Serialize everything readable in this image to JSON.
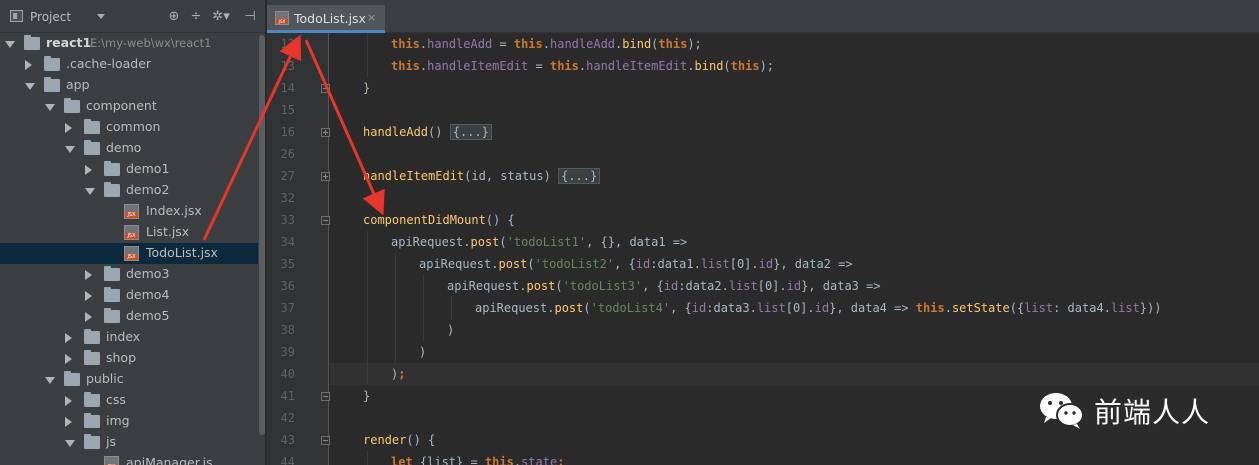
{
  "project_panel": {
    "title": "Project",
    "toolbar_icons": [
      "globe-sync-icon",
      "collapse-all-icon",
      "settings-gear-icon",
      "hide-panel-icon"
    ],
    "tree": [
      {
        "label": "react1",
        "path": "E:\\my-web\\wx\\react1",
        "type": "folder",
        "expanded": true,
        "depth": 0
      },
      {
        "label": ".cache-loader",
        "type": "folder",
        "expanded": false,
        "depth": 1
      },
      {
        "label": "app",
        "type": "folder",
        "expanded": true,
        "depth": 1
      },
      {
        "label": "component",
        "type": "folder",
        "expanded": true,
        "depth": 2
      },
      {
        "label": "common",
        "type": "folder",
        "expanded": false,
        "depth": 3
      },
      {
        "label": "demo",
        "type": "folder",
        "expanded": true,
        "depth": 3
      },
      {
        "label": "demo1",
        "type": "folder",
        "expanded": false,
        "depth": 4
      },
      {
        "label": "demo2",
        "type": "folder",
        "expanded": true,
        "depth": 4
      },
      {
        "label": "Index.jsx",
        "type": "file",
        "depth": 5
      },
      {
        "label": "List.jsx",
        "type": "file",
        "depth": 5
      },
      {
        "label": "TodoList.jsx",
        "type": "file",
        "depth": 5,
        "selected": true
      },
      {
        "label": "demo3",
        "type": "folder",
        "expanded": false,
        "depth": 4
      },
      {
        "label": "demo4",
        "type": "folder",
        "expanded": false,
        "depth": 4
      },
      {
        "label": "demo5",
        "type": "folder",
        "expanded": false,
        "depth": 4
      },
      {
        "label": "index",
        "type": "folder",
        "expanded": false,
        "depth": 3
      },
      {
        "label": "shop",
        "type": "folder",
        "expanded": false,
        "depth": 3
      },
      {
        "label": "public",
        "type": "folder",
        "expanded": true,
        "depth": 2
      },
      {
        "label": "css",
        "type": "folder",
        "expanded": false,
        "depth": 3
      },
      {
        "label": "img",
        "type": "folder",
        "expanded": false,
        "depth": 3
      },
      {
        "label": "js",
        "type": "folder",
        "expanded": true,
        "depth": 3
      },
      {
        "label": "apiManager.js",
        "type": "file",
        "depth": 4
      }
    ]
  },
  "editor": {
    "tab": {
      "label": "TodoList.jsx",
      "close": "×"
    },
    "lines": [
      {
        "num": "12",
        "indent": 2,
        "fold": null,
        "tokens": [
          [
            "kw",
            "this"
          ],
          [
            "pl",
            "."
          ],
          [
            "pr",
            "handleAdd"
          ],
          [
            "pl",
            " = "
          ],
          [
            "kw",
            "this"
          ],
          [
            "pl",
            "."
          ],
          [
            "pr",
            "handleAdd"
          ],
          [
            "pl",
            "."
          ],
          [
            "fn",
            "bind"
          ],
          [
            "pl",
            "("
          ],
          [
            "kw",
            "this"
          ],
          [
            "pl",
            ");"
          ]
        ]
      },
      {
        "num": "13",
        "indent": 2,
        "fold": null,
        "tokens": [
          [
            "kw",
            "this"
          ],
          [
            "pl",
            "."
          ],
          [
            "pr",
            "handleItemEdit"
          ],
          [
            "pl",
            " = "
          ],
          [
            "kw",
            "this"
          ],
          [
            "pl",
            "."
          ],
          [
            "pr",
            "handleItemEdit"
          ],
          [
            "pl",
            "."
          ],
          [
            "fn",
            "bind"
          ],
          [
            "pl",
            "("
          ],
          [
            "kw",
            "this"
          ],
          [
            "pl",
            ");"
          ]
        ]
      },
      {
        "num": "14",
        "indent": 1,
        "fold": "minus",
        "tokens": [
          [
            "pl",
            "}"
          ]
        ]
      },
      {
        "num": "15",
        "indent": 0,
        "fold": null,
        "tokens": []
      },
      {
        "num": "16",
        "indent": 1,
        "fold": "plus",
        "tokens": [
          [
            "fn",
            "handleAdd"
          ],
          [
            "pl",
            "() "
          ],
          [
            "fb",
            "{...}"
          ]
        ]
      },
      {
        "num": "26",
        "indent": 0,
        "fold": null,
        "tokens": []
      },
      {
        "num": "27",
        "indent": 1,
        "fold": "plus",
        "tokens": [
          [
            "fn",
            "handleItemEdit"
          ],
          [
            "pl",
            "(id, status) "
          ],
          [
            "fb",
            "{...}"
          ]
        ]
      },
      {
        "num": "32",
        "indent": 0,
        "fold": null,
        "tokens": []
      },
      {
        "num": "33",
        "indent": 1,
        "fold": "minus",
        "tokens": [
          [
            "fn",
            "componentDidMount"
          ],
          [
            "pl",
            "() {"
          ]
        ]
      },
      {
        "num": "34",
        "indent": 2,
        "fold": null,
        "tokens": [
          [
            "pl",
            "apiRequest."
          ],
          [
            "fn",
            "post"
          ],
          [
            "pl",
            "("
          ],
          [
            "st",
            "'todoList1'"
          ],
          [
            "pl",
            ", {}, data1 =>"
          ]
        ]
      },
      {
        "num": "35",
        "indent": 3,
        "fold": null,
        "tokens": [
          [
            "pl",
            "apiRequest."
          ],
          [
            "fn",
            "post"
          ],
          [
            "pl",
            "("
          ],
          [
            "st",
            "'todoList2'"
          ],
          [
            "pl",
            ", {"
          ],
          [
            "pr",
            "id"
          ],
          [
            "pl",
            ":data1."
          ],
          [
            "pr",
            "list"
          ],
          [
            "pl",
            "[0]."
          ],
          [
            "pr",
            "id"
          ],
          [
            "pl",
            "}, data2 =>"
          ]
        ]
      },
      {
        "num": "36",
        "indent": 4,
        "fold": null,
        "tokens": [
          [
            "pl",
            "apiRequest."
          ],
          [
            "fn",
            "post"
          ],
          [
            "pl",
            "("
          ],
          [
            "st",
            "'todoList3'"
          ],
          [
            "pl",
            ", {"
          ],
          [
            "pr",
            "id"
          ],
          [
            "pl",
            ":data2."
          ],
          [
            "pr",
            "list"
          ],
          [
            "pl",
            "[0]."
          ],
          [
            "pr",
            "id"
          ],
          [
            "pl",
            "}, data3 =>"
          ]
        ]
      },
      {
        "num": "37",
        "indent": 5,
        "fold": null,
        "tokens": [
          [
            "pl",
            "apiRequest."
          ],
          [
            "fn",
            "post"
          ],
          [
            "pl",
            "("
          ],
          [
            "st",
            "'todoList4'"
          ],
          [
            "pl",
            ", {"
          ],
          [
            "pr",
            "id"
          ],
          [
            "pl",
            ":data3."
          ],
          [
            "pr",
            "list"
          ],
          [
            "pl",
            "[0]."
          ],
          [
            "pr",
            "id"
          ],
          [
            "pl",
            "}, data4 => "
          ],
          [
            "kw",
            "this"
          ],
          [
            "pl",
            "."
          ],
          [
            "fn",
            "setState"
          ],
          [
            "pl",
            "({"
          ],
          [
            "pr",
            "list"
          ],
          [
            "pl",
            ": data4."
          ],
          [
            "pr",
            "list"
          ],
          [
            "pl",
            "}))"
          ]
        ]
      },
      {
        "num": "38",
        "indent": 4,
        "fold": null,
        "tokens": [
          [
            "pl",
            ")"
          ]
        ]
      },
      {
        "num": "39",
        "indent": 3,
        "fold": null,
        "tokens": [
          [
            "pl",
            ")"
          ]
        ]
      },
      {
        "num": "40",
        "indent": 2,
        "fold": null,
        "current": true,
        "tokens": [
          [
            "pl",
            ")"
          ],
          [
            "kw",
            ";"
          ]
        ]
      },
      {
        "num": "41",
        "indent": 1,
        "fold": "minus",
        "tokens": [
          [
            "pl",
            "}"
          ]
        ]
      },
      {
        "num": "42",
        "indent": 0,
        "fold": null,
        "tokens": []
      },
      {
        "num": "43",
        "indent": 1,
        "fold": "minus",
        "tokens": [
          [
            "fn",
            "render"
          ],
          [
            "pl",
            "() {"
          ]
        ]
      },
      {
        "num": "44",
        "indent": 2,
        "fold": null,
        "tokens": [
          [
            "kw",
            "let"
          ],
          [
            "pl",
            " {list} = "
          ],
          [
            "kw",
            "this"
          ],
          [
            "pl",
            "."
          ],
          [
            "pr",
            "state"
          ],
          [
            "kw",
            ";"
          ]
        ]
      }
    ]
  },
  "watermark": {
    "text": "前端人人",
    "icon": "wechat-icon"
  },
  "colors": {
    "arrow": "#e8362c",
    "keyword": "#cc7832",
    "function": "#ffc66d",
    "string": "#6a8759",
    "property": "#9876aa",
    "selection": "#0d293e"
  }
}
